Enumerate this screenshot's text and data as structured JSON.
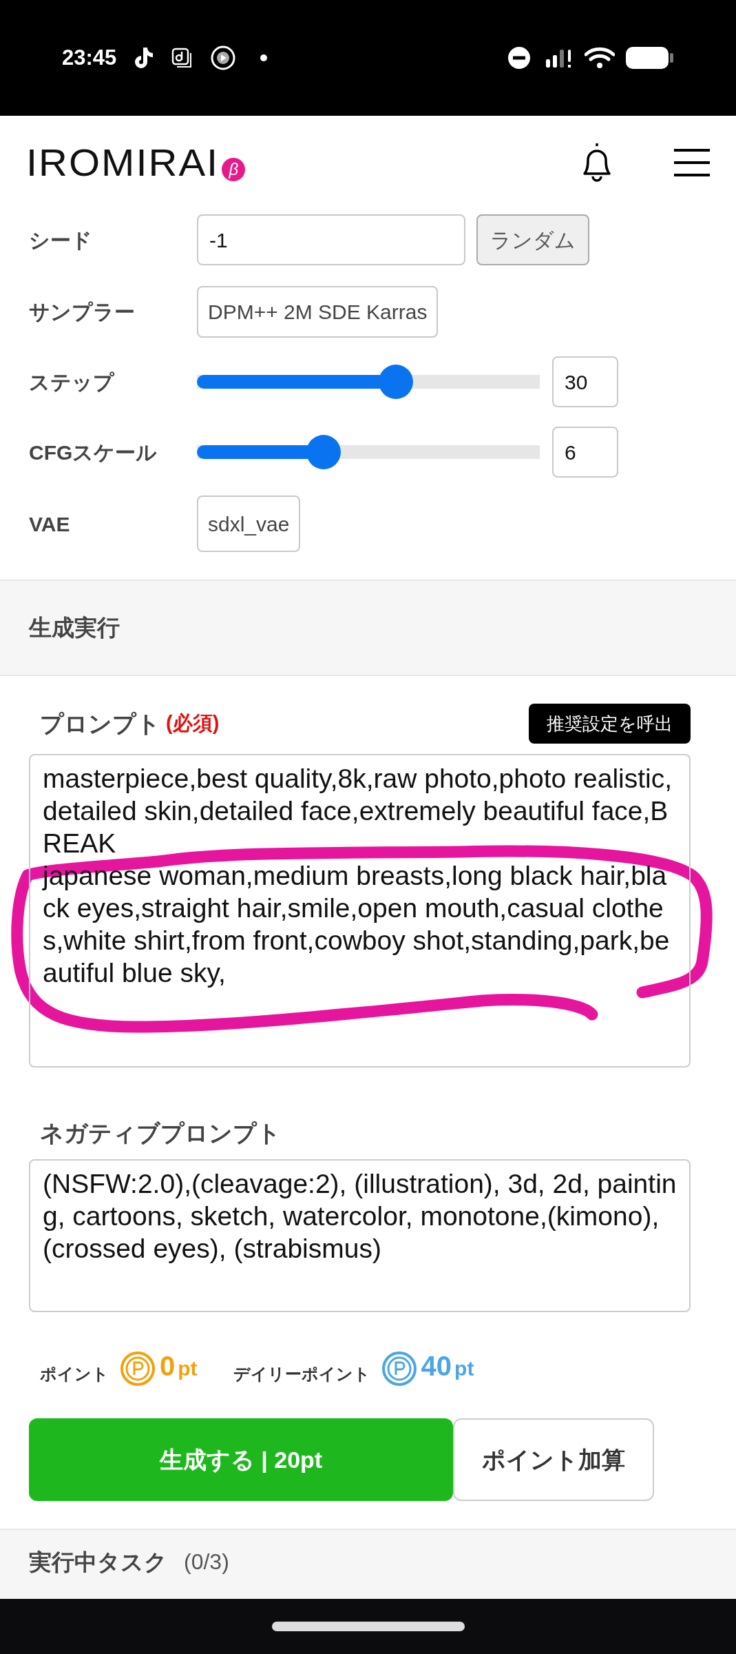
{
  "status_bar": {
    "time": "23:45"
  },
  "header": {
    "logo": "IROMIRAI",
    "logo_badge": "β"
  },
  "settings": [
    {
      "kind": "input_button",
      "label": "シード",
      "value": "-1",
      "button": "ランダム"
    },
    {
      "kind": "text",
      "label": "サンプラー",
      "value": "DPM++ 2M SDE Karras"
    },
    {
      "kind": "slider",
      "label": "ステップ",
      "level": 0.58,
      "value": "30"
    },
    {
      "kind": "slider",
      "label": "CFGスケール",
      "level": 0.37,
      "value": "6"
    },
    {
      "kind": "text",
      "label": "VAE",
      "value": "sdxl_vae"
    }
  ],
  "section_title": "生成実行",
  "prompt": {
    "label": "プロンプト",
    "required": "(必須)",
    "button": "推奨設定を呼出",
    "value": "masterpiece,best quality,8k,raw photo,photo realistic,detailed skin,detailed face,extremely beautiful face,BREAK\njapanese woman,medium breasts,long black hair,black eyes,straight hair,smile,open mouth,casual clothes,white shirt,from front,cowboy shot,standing,park,beautiful blue sky,"
  },
  "negative_prompt": {
    "label": "ネガティブプロンプト",
    "value": "(NSFW:2.0),(cleavage:2), (illustration), 3d, 2d, painting, cartoons, sketch, watercolor, monotone,(kimono), (crossed eyes), (strabismus)"
  },
  "points": [
    {
      "label": "ポイント",
      "amount": "0",
      "unit": "pt",
      "color": "#f0a20c"
    },
    {
      "label": "デイリーポイント",
      "amount": "40",
      "unit": "pt",
      "color": "#4ba5e6"
    }
  ],
  "actions": {
    "generate": "生成する | 20pt",
    "add_points": "ポイント加算"
  },
  "tasks": {
    "title": "実行中タスク",
    "count": "(0/3)"
  }
}
